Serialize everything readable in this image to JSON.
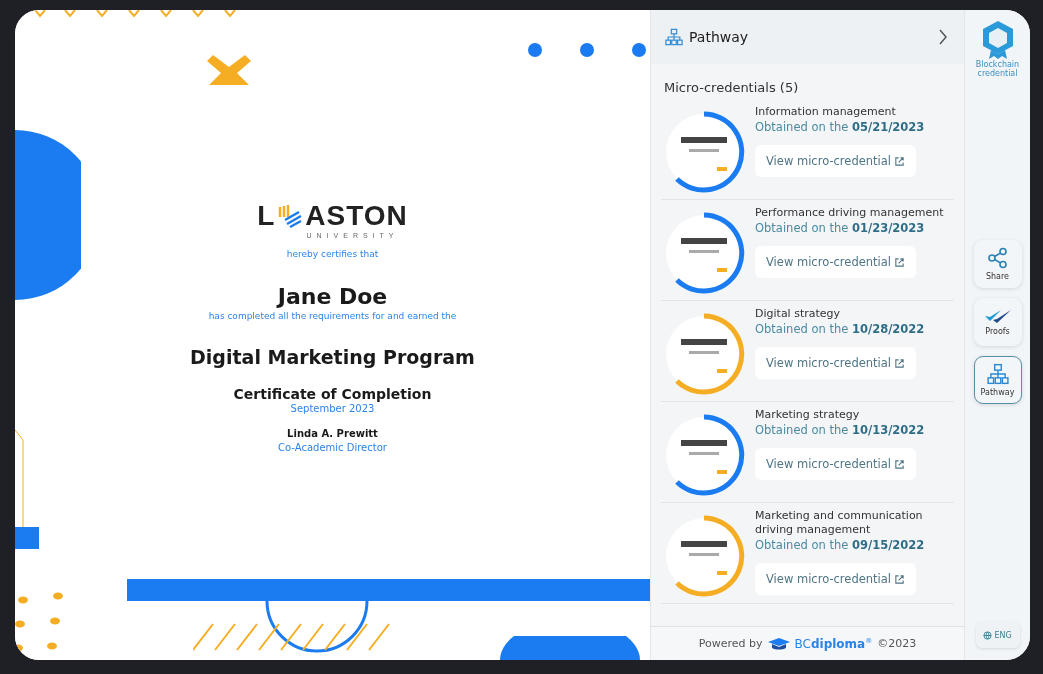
{
  "certificate": {
    "logo": {
      "left": "L",
      "right": "ASTON",
      "sub": "UNIVERSITY"
    },
    "intro": "hereby certifies that",
    "recipient": "Jane Doe",
    "statement": "has completed all the requirements for and earned the",
    "program": "Digital Marketing Program",
    "award": "Certificate of Completion",
    "date": "September 2023",
    "signer": "Linda A. Prewitt",
    "signer_role": "Co-Academic Director"
  },
  "panel": {
    "title": "Pathway",
    "section": "Micro-credentials (5)",
    "items": [
      {
        "name": "Information management",
        "obtained": "Obtained on the **05/21/2023**",
        "link": "View micro-credential",
        "color": "#1a7cf0"
      },
      {
        "name": "Performance driving management",
        "obtained": "Obtained on the **01/23/2023**",
        "link": "View micro-credential",
        "color": "#1a7cf0"
      },
      {
        "name": "Digital strategy",
        "obtained": "Obtained on the **10/28/2022**",
        "link": "View micro-credential",
        "color": "#f5ae24"
      },
      {
        "name": "Marketing strategy",
        "obtained": "Obtained on the **10/13/2022**",
        "link": "View micro-credential",
        "color": "#1a7cf0"
      },
      {
        "name": "Marketing and communication driving management",
        "obtained": "Obtained on the **09/15/2022**",
        "link": "View micro-credential",
        "color": "#f5ae24"
      }
    ],
    "footer": {
      "prefix": "Powered by",
      "brand": "BC**diploma**$^{®}$",
      "copyright": "©2023"
    }
  },
  "rail": {
    "brand": "Blockchain credential",
    "buttons": [
      {
        "kind": "share",
        "label": "Share",
        "selected": false
      },
      {
        "kind": "proofs",
        "label": "Proofs",
        "selected": false
      },
      {
        "kind": "pathway",
        "label": "Pathway",
        "selected": true
      }
    ],
    "language": "ENG"
  }
}
